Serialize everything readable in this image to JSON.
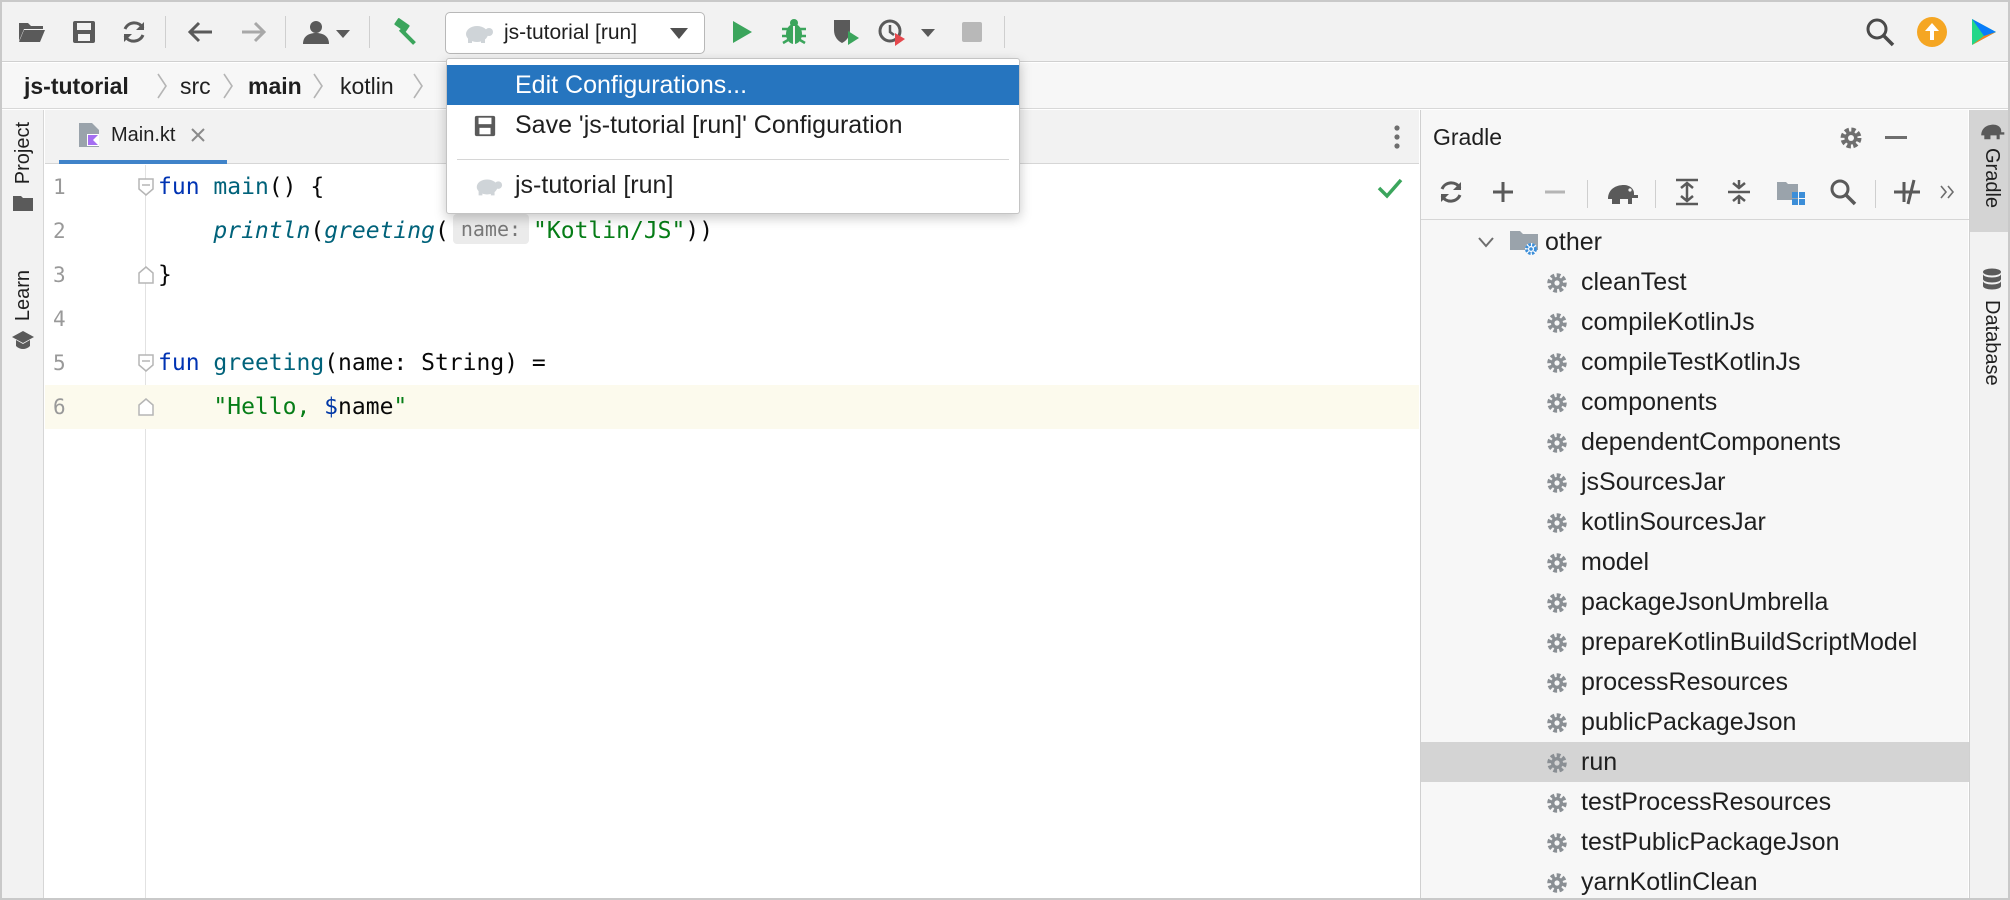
{
  "run_config": {
    "label": "js-tutorial [run]"
  },
  "breadcrumb": [
    "js-tutorial",
    "src",
    "main",
    "kotlin"
  ],
  "left_strip": {
    "project": "Project",
    "learn": "Learn"
  },
  "editor": {
    "tab": {
      "name": "Main.kt"
    },
    "lines": [
      {
        "no": "1"
      },
      {
        "no": "2"
      },
      {
        "no": "3"
      },
      {
        "no": "4"
      },
      {
        "no": "5"
      },
      {
        "no": "6"
      }
    ],
    "code": {
      "l1_kw": "fun",
      "l1_fn": "main",
      "l1_rest": "() {",
      "l2_fn": "println",
      "l2_p1": "(",
      "l2_fn2": "greeting",
      "l2_p2": "(",
      "l2_hint": "name:",
      "l2_str": "\"Kotlin/JS\"",
      "l2_close": "))",
      "l3": "}",
      "l5_kw": "fun",
      "l5_fn": "greeting",
      "l5_rest": "(name: String) =",
      "l6_str1": "\"Hello, ",
      "l6_tpl": "$",
      "l6_name": "name",
      "l6_str2": "\""
    }
  },
  "gradle": {
    "title": "Gradle",
    "group": "other",
    "tasks": [
      "cleanTest",
      "compileKotlinJs",
      "compileTestKotlinJs",
      "components",
      "dependentComponents",
      "jsSourcesJar",
      "kotlinSourcesJar",
      "model",
      "packageJsonUmbrella",
      "prepareKotlinBuildScriptModel",
      "processResources",
      "publicPackageJson",
      "run",
      "testProcessResources",
      "testPublicPackageJson",
      "yarnKotlinClean"
    ],
    "selected_task": "run"
  },
  "right_strip": {
    "gradle": "Gradle",
    "database": "Database"
  },
  "popup": {
    "items": [
      {
        "label": "Edit Configurations...",
        "icon": "none"
      },
      {
        "label": "Save 'js-tutorial [run]' Configuration",
        "icon": "save-icon"
      },
      {
        "label": "js-tutorial [run]",
        "icon": "turtle-icon"
      }
    ]
  },
  "colors": {
    "accent": "#2675bf",
    "run_green": "#3ba55c",
    "keyword": "#0033b3",
    "function": "#00627a",
    "string": "#067d17",
    "update_badge": "#f5a623"
  }
}
